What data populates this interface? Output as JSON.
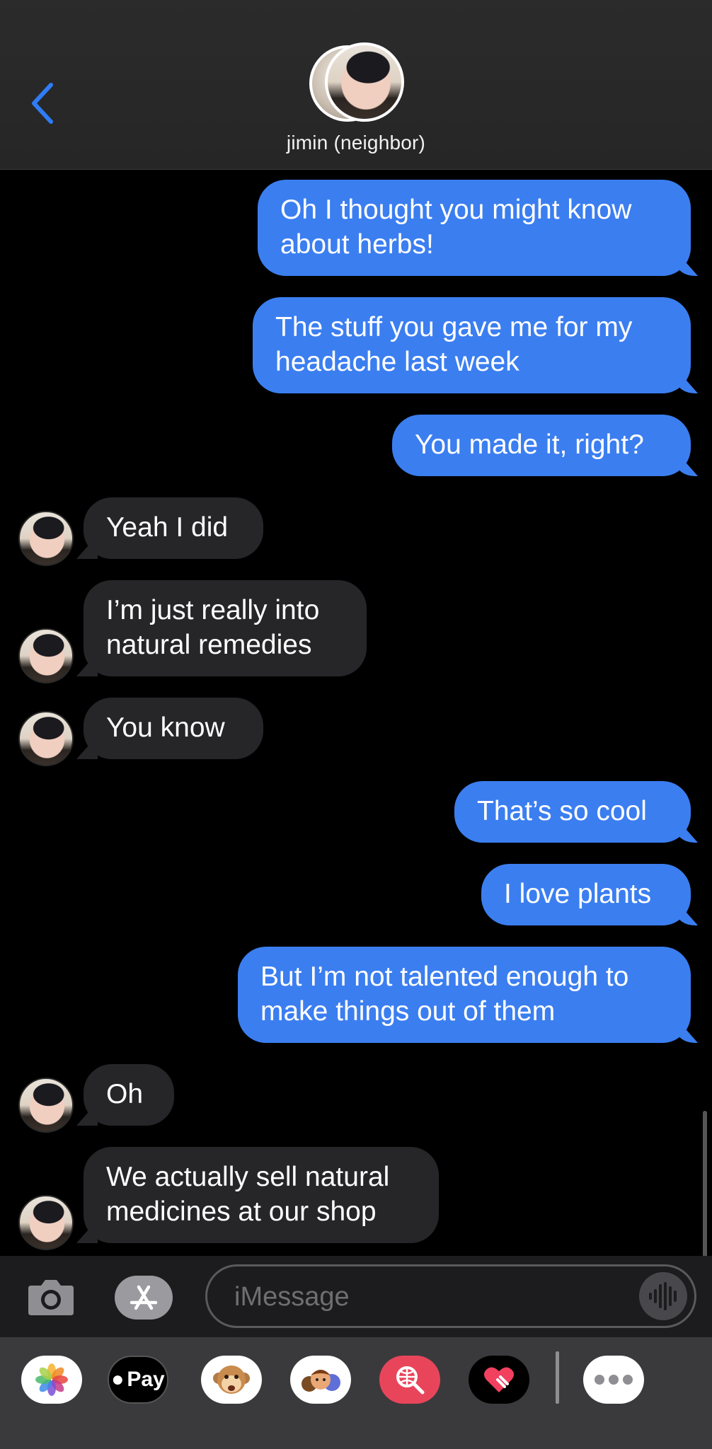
{
  "header": {
    "contact_name": "jimin (neighbor)"
  },
  "thread": {
    "messages": [
      {
        "direction": "outgoing",
        "text": "Oh I thought you might know\nabout herbs!"
      },
      {
        "direction": "outgoing",
        "text": "The stuff you gave me for my\nheadache last week"
      },
      {
        "direction": "outgoing",
        "text": "You made it, right?"
      },
      {
        "direction": "incoming",
        "text": "Yeah I did"
      },
      {
        "direction": "incoming",
        "text": "I’m just really into\nnatural remedies"
      },
      {
        "direction": "incoming",
        "text": "You know"
      },
      {
        "direction": "outgoing",
        "text": "That’s so cool"
      },
      {
        "direction": "outgoing",
        "text": "I love plants"
      },
      {
        "direction": "outgoing",
        "text": "But I’m not talented enough to\nmake things out of them"
      },
      {
        "direction": "incoming",
        "text": "Oh"
      },
      {
        "direction": "incoming",
        "text": "We actually sell natural\nmedicines at our shop"
      }
    ]
  },
  "input_bar": {
    "placeholder": "iMessage",
    "value": ""
  },
  "app_drawer": {
    "apps": [
      {
        "name": "photos-app-icon"
      },
      {
        "name": "apple-pay-app",
        "label": "Pay"
      },
      {
        "name": "animoji-app-icon"
      },
      {
        "name": "memoji-stickers-app-icon"
      },
      {
        "name": "images-search-app-icon"
      },
      {
        "name": "digital-touch-app-icon"
      },
      {
        "name": "more-apps-icon"
      }
    ]
  },
  "colors": {
    "outgoing_bubble": "#3b7ef0",
    "incoming_bubble": "#262628",
    "background": "#000000",
    "accent": "#2f7cf6"
  }
}
